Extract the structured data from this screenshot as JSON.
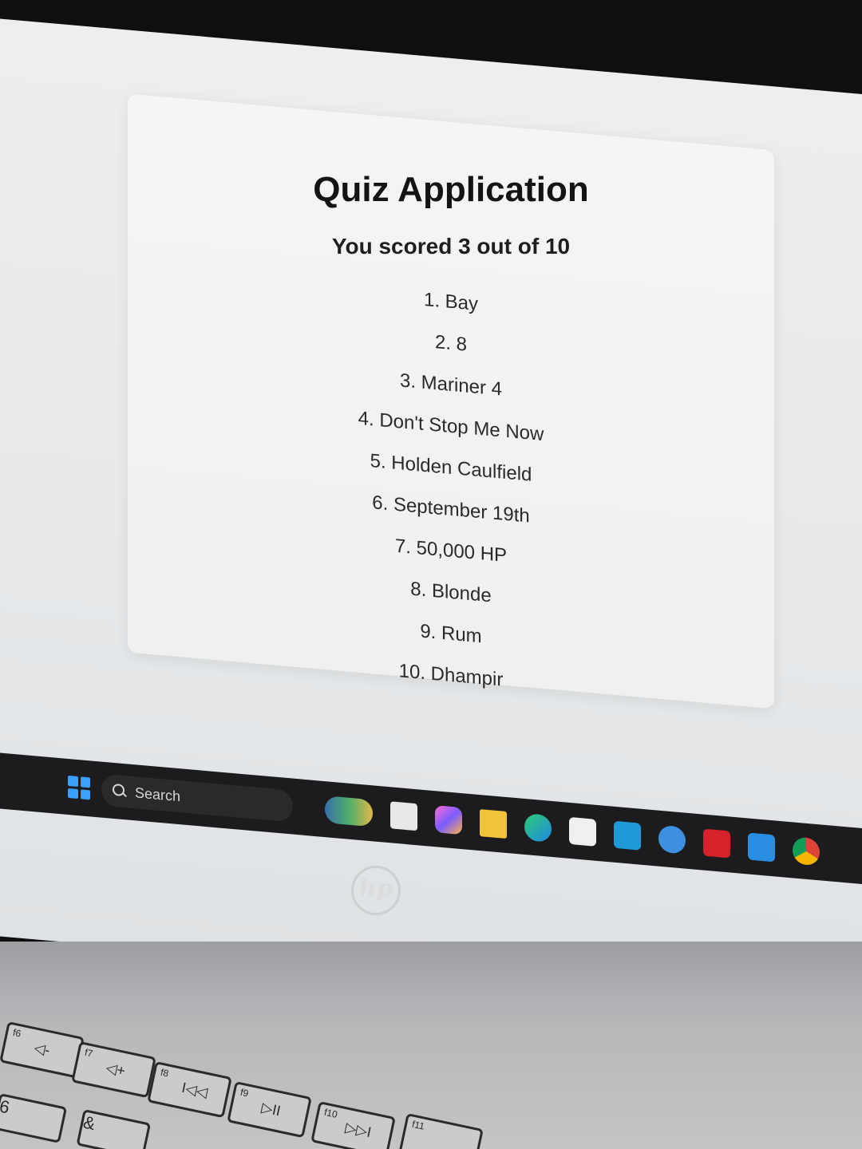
{
  "quiz": {
    "title": "Quiz Application",
    "score_text": "You scored 3 out of 10",
    "answers": [
      "1. Bay",
      "2. 8",
      "3. Mariner 4",
      "4. Don't Stop Me Now",
      "5. Holden Caulfield",
      "6. September 19th",
      "7. 50,000 HP",
      "8. Blonde",
      "9. Rum",
      "10. Dhampir"
    ]
  },
  "taskbar": {
    "search_label": "Search",
    "icons": [
      "widgets-icon",
      "task-view-icon",
      "copilot-icon",
      "file-explorer-icon",
      "edge-icon",
      "store-icon",
      "myhp-icon",
      "help-icon",
      "mcafee-icon",
      "vscode-icon",
      "chrome-icon"
    ],
    "tray_chevron": "^"
  },
  "bezel": {
    "logo": "hp"
  },
  "keyboard": {
    "keys": [
      {
        "fn": "f6",
        "glyph": "◁-"
      },
      {
        "fn": "f7",
        "glyph": "◁+"
      },
      {
        "fn": "f8",
        "glyph": "I◁◁"
      },
      {
        "fn": "f9",
        "glyph": "▷II"
      },
      {
        "fn": "f10",
        "glyph": "▷▷I"
      },
      {
        "fn": "f11",
        "glyph": ""
      }
    ],
    "row2": [
      "6",
      "&"
    ]
  }
}
